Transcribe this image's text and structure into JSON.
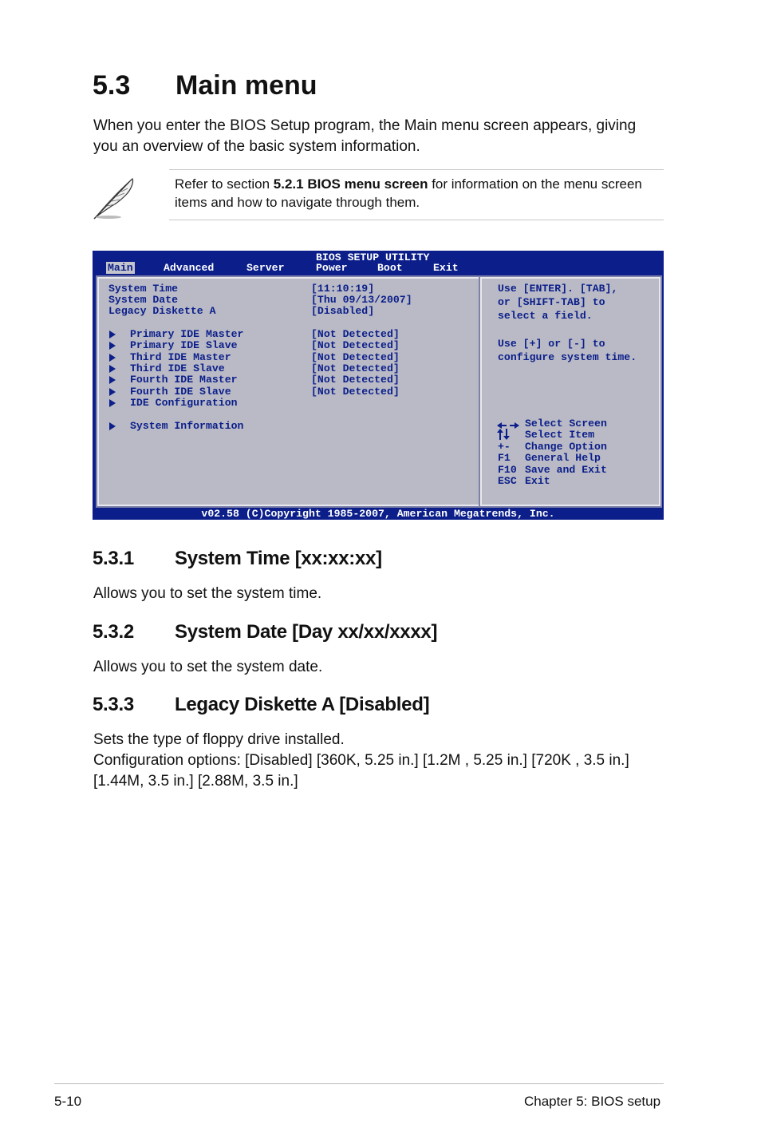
{
  "section": {
    "number": "5.3",
    "title": "Main menu"
  },
  "intro": "When you enter the BIOS Setup program, the Main menu screen appears, giving you an overview of the basic system information.",
  "note": {
    "prefix": "Refer to section ",
    "bold": "5.2.1  BIOS menu screen",
    "suffix": " for information on the menu screen items and how to navigate through them.",
    "icon": "feather-quill-icon"
  },
  "bios": {
    "title": "BIOS SETUP UTILITY",
    "menu": [
      "Main",
      "Advanced",
      "Server",
      "Power",
      "Boot",
      "Exit"
    ],
    "selected_menu": "Main",
    "items": [
      {
        "label": "System Time",
        "value": "[11:10:19]",
        "arrow": false
      },
      {
        "label": "System Date",
        "value": "[Thu 09/13/2007]",
        "arrow": false
      },
      {
        "label": "Legacy Diskette A",
        "value": "[Disabled]",
        "arrow": false
      },
      {
        "label": "Primary IDE Master",
        "value": "[Not Detected]",
        "arrow": true
      },
      {
        "label": "Primary IDE Slave",
        "value": "[Not Detected]",
        "arrow": true
      },
      {
        "label": "Third IDE Master",
        "value": "[Not Detected]",
        "arrow": true
      },
      {
        "label": "Third IDE Slave",
        "value": "[Not Detected]",
        "arrow": true
      },
      {
        "label": "Fourth IDE Master",
        "value": "[Not Detected]",
        "arrow": true
      },
      {
        "label": "Fourth IDE Slave",
        "value": "[Not Detected]",
        "arrow": true
      },
      {
        "label": "IDE Configuration",
        "value": "",
        "arrow": true
      },
      {
        "label": "System Information",
        "value": "",
        "arrow": true
      }
    ],
    "help": [
      "Use [ENTER]. [TAB],",
      "or [SHIFT-TAB] to",
      "select a field.",
      "",
      "Use [+] or [-] to",
      "configure system time."
    ],
    "keys": [
      {
        "key": "",
        "icon": "left-right-arrows-icon",
        "desc": "Select Screen"
      },
      {
        "key": "",
        "icon": "up-down-arrows-icon",
        "desc": "Select Item"
      },
      {
        "key": "+-",
        "desc": "Change Option"
      },
      {
        "key": "F1",
        "desc": "General Help"
      },
      {
        "key": "F10",
        "desc": "Save and Exit"
      },
      {
        "key": "ESC",
        "desc": "Exit"
      }
    ],
    "footer": "v02.58 (C)Copyright 1985-2007, American Megatrends, Inc."
  },
  "subsections": [
    {
      "number": "5.3.1",
      "title": "System Time [xx:xx:xx]",
      "body": [
        "Allows you to set the system time."
      ]
    },
    {
      "number": "5.3.2",
      "title": "System Date [Day xx/xx/xxxx]",
      "body": [
        "Allows you to set the system date."
      ]
    },
    {
      "number": "5.3.3",
      "title": "Legacy Diskette A [Disabled]",
      "body": [
        "Sets the type of floppy drive installed.",
        "Configuration options: [Disabled] [360K, 5.25 in.] [1.2M , 5.25 in.] [720K , 3.5 in.] [1.44M, 3.5 in.] [2.88M, 3.5 in.]"
      ]
    }
  ],
  "footer": {
    "page": "5-10",
    "chapter": "Chapter 5: BIOS setup"
  }
}
